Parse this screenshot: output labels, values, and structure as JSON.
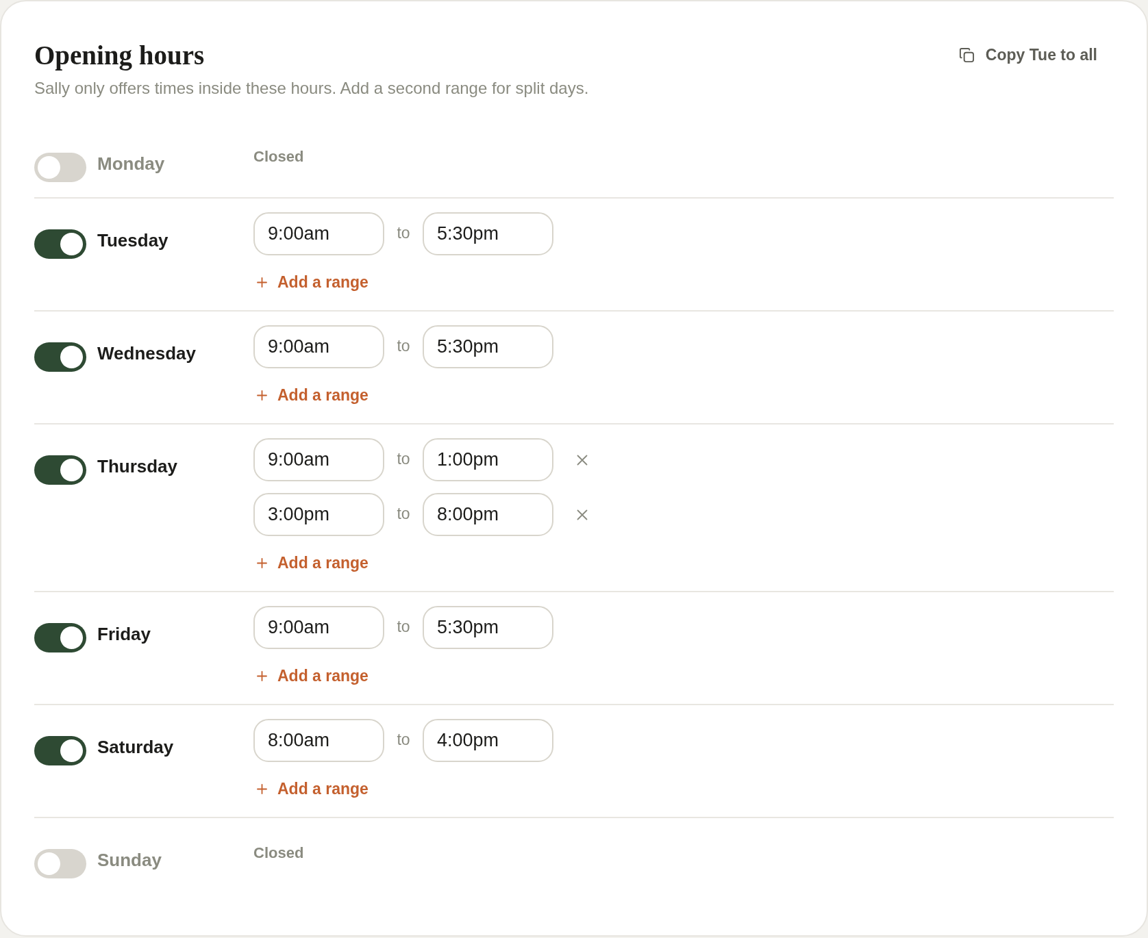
{
  "header": {
    "title": "Opening hours",
    "subtitle": "Sally only offers times inside these hours. Add a second range for split days.",
    "copy_button": {
      "label": "Copy Tue to all"
    }
  },
  "days": [
    {
      "name": "Monday",
      "on": false,
      "closed_label": "Closed"
    },
    {
      "name": "Tuesday",
      "on": true,
      "ranges": [
        {
          "from": "9:00am",
          "separator": "to",
          "to": "5:30pm",
          "removable": false
        }
      ],
      "add_range": "Add a range"
    },
    {
      "name": "Wednesday",
      "on": true,
      "ranges": [
        {
          "from": "9:00am",
          "separator": "to",
          "to": "5:30pm",
          "removable": false
        }
      ],
      "add_range": "Add a range"
    },
    {
      "name": "Thursday",
      "on": true,
      "ranges": [
        {
          "from": "9:00am",
          "separator": "to",
          "to": "1:00pm",
          "removable": true
        },
        {
          "from": "3:00pm",
          "separator": "to",
          "to": "8:00pm",
          "removable": true
        }
      ],
      "add_range": "Add a range"
    },
    {
      "name": "Friday",
      "on": true,
      "ranges": [
        {
          "from": "9:00am",
          "separator": "to",
          "to": "5:30pm",
          "removable": false
        }
      ],
      "add_range": "Add a range"
    },
    {
      "name": "Saturday",
      "on": true,
      "ranges": [
        {
          "from": "8:00am",
          "separator": "to",
          "to": "4:00pm",
          "removable": false
        }
      ],
      "add_range": "Add a range"
    },
    {
      "name": "Sunday",
      "on": false,
      "closed_label": "Closed"
    }
  ]
}
